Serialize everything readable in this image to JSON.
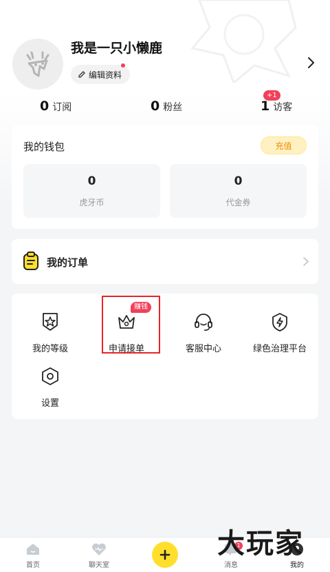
{
  "profile": {
    "nickname": "我是一只小懒鹿",
    "edit_label": "编辑资料"
  },
  "stats": [
    {
      "value": "0",
      "label": "订阅"
    },
    {
      "value": "0",
      "label": "粉丝"
    },
    {
      "value": "1",
      "label": "访客",
      "badge": "+1"
    }
  ],
  "wallet": {
    "title": "我的钱包",
    "recharge_label": "充值",
    "boxes": [
      {
        "value": "0",
        "label": "虎牙币"
      },
      {
        "value": "0",
        "label": "代金券"
      }
    ]
  },
  "orders": {
    "title": "我的订单"
  },
  "menu": {
    "items": [
      {
        "label": "我的等级",
        "icon": "level-badge-icon"
      },
      {
        "label": "申请接单",
        "icon": "crown-icon",
        "badge": "赚钱"
      },
      {
        "label": "客服中心",
        "icon": "headset-icon"
      },
      {
        "label": "绿色治理平台",
        "icon": "shield-lightning-icon"
      },
      {
        "label": "设置",
        "icon": "settings-hexagon-icon"
      }
    ]
  },
  "tabbar": {
    "items": [
      {
        "label": "首页",
        "icon": "home-icon"
      },
      {
        "label": "聊天室",
        "icon": "heart-chat-icon"
      },
      {
        "label": "",
        "icon": "plus-icon"
      },
      {
        "label": "消息",
        "icon": "message-icon",
        "badge": "1"
      },
      {
        "label": "我的",
        "icon": "profile-icon",
        "active": true
      }
    ]
  },
  "watermark": "大玩家",
  "colors": {
    "accent_yellow": "#ffdf2b",
    "badge_red": "#f2405a",
    "highlight_red": "#e52525",
    "recharge_text": "#f08c00"
  }
}
